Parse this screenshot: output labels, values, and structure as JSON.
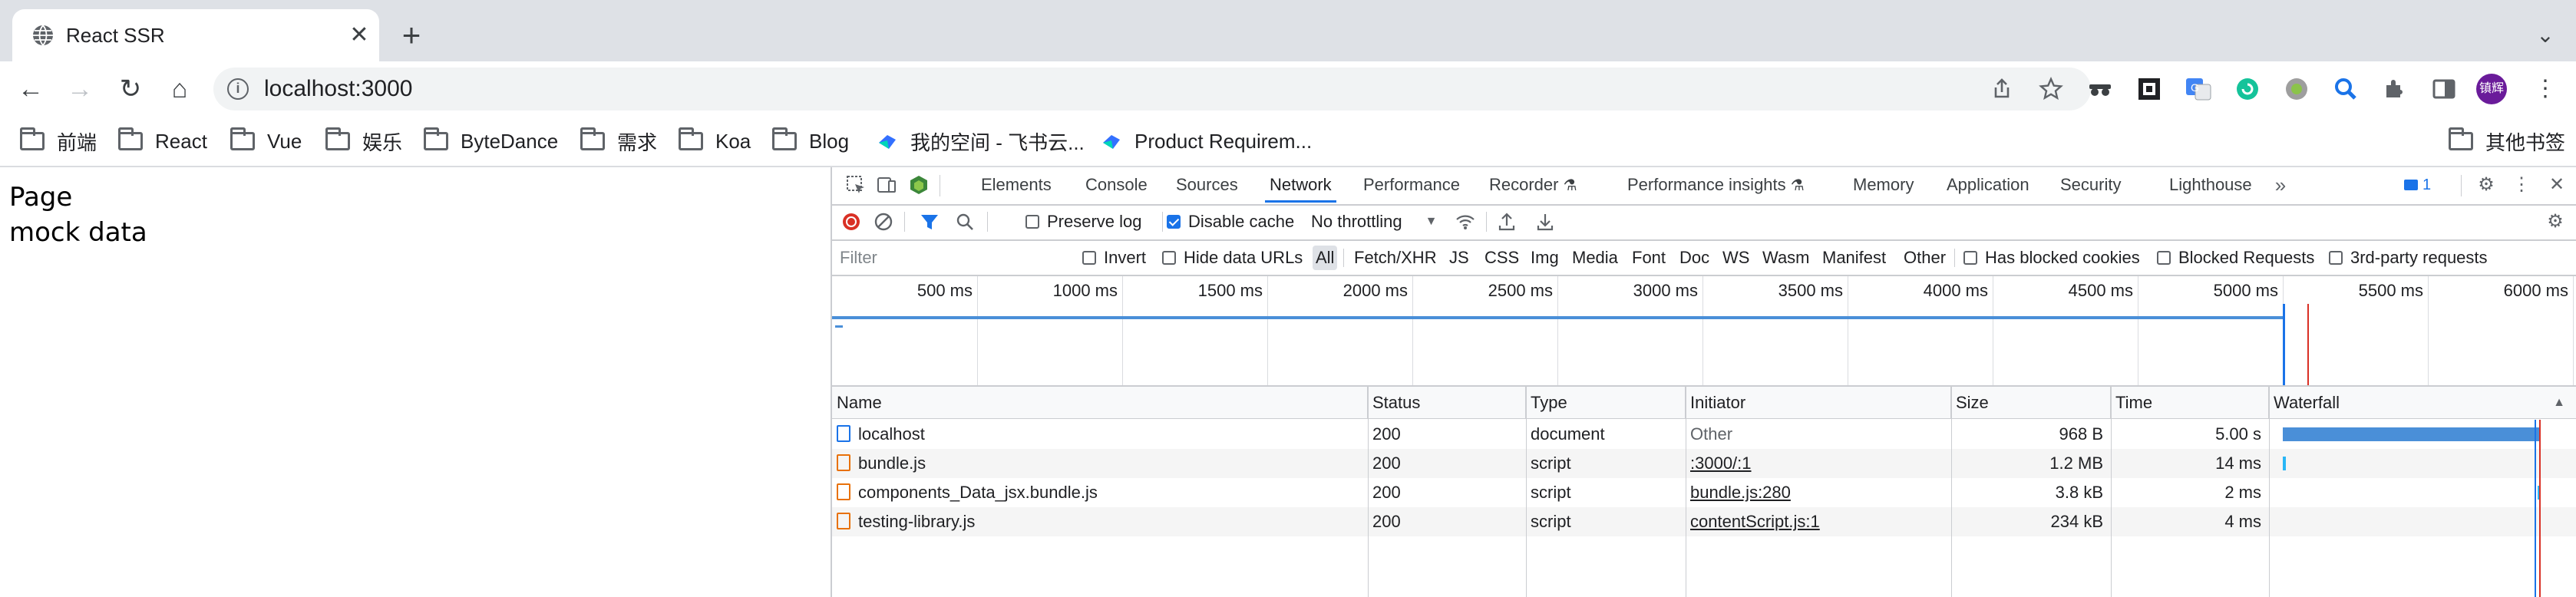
{
  "browser": {
    "tab": {
      "title": "React SSR",
      "favicon": "globe-icon",
      "close_glyph": "✕"
    },
    "new_tab_glyph": "+",
    "tab_menu_glyph": "⌄",
    "address": {
      "url": "localhost:3000"
    },
    "nav": {
      "back": "←",
      "forward": "→",
      "reload": "↻",
      "home": "⌂"
    },
    "profile_initials": "镇辉",
    "colors": {
      "tabstrip": "#dee1e6",
      "accent": "#1a73e8",
      "profile": "#6a1b9a"
    }
  },
  "bookmarks": {
    "items": [
      {
        "label": "前端",
        "icon": "folder-icon"
      },
      {
        "label": "React",
        "icon": "folder-icon"
      },
      {
        "label": "Vue",
        "icon": "folder-icon"
      },
      {
        "label": "娱乐",
        "icon": "folder-icon"
      },
      {
        "label": "ByteDance",
        "icon": "folder-icon"
      },
      {
        "label": "需求",
        "icon": "folder-icon"
      },
      {
        "label": "Koa",
        "icon": "folder-icon"
      },
      {
        "label": "Blog",
        "icon": "folder-icon"
      },
      {
        "label": "我的空间 - 飞书云...",
        "icon": "feishu-icon"
      },
      {
        "label": "Product Requirem...",
        "icon": "feishu-icon"
      }
    ],
    "other": "其他书签"
  },
  "page": {
    "lines": [
      "Page",
      "mock data"
    ]
  },
  "devtools": {
    "tabs": [
      "Elements",
      "Console",
      "Sources",
      "Network",
      "Performance",
      "Recorder",
      "Performance insights",
      "Memory",
      "Application",
      "Security",
      "Lighthouse"
    ],
    "active_tab": "Network",
    "issues_count": "1",
    "toolbar": {
      "preserve_log": "Preserve log",
      "disable_cache": "Disable cache",
      "throttling": "No throttling"
    },
    "filter": {
      "placeholder": "Filter",
      "invert": "Invert",
      "hide_data_urls": "Hide data URLs",
      "types": [
        "All",
        "Fetch/XHR",
        "JS",
        "CSS",
        "Img",
        "Media",
        "Font",
        "Doc",
        "WS",
        "Wasm",
        "Manifest",
        "Other"
      ],
      "active_type": "All",
      "has_blocked_cookies": "Has blocked cookies",
      "blocked_requests": "Blocked Requests",
      "third_party": "3rd-party requests"
    },
    "overview_ticks": [
      "500 ms",
      "1000 ms",
      "1500 ms",
      "2000 ms",
      "2500 ms",
      "3000 ms",
      "3500 ms",
      "4000 ms",
      "4500 ms",
      "5000 ms",
      "5500 ms",
      "6000 ms"
    ],
    "columns": [
      "Name",
      "Status",
      "Type",
      "Initiator",
      "Size",
      "Time",
      "Waterfall"
    ],
    "rows": [
      {
        "name": "localhost",
        "kind": "document",
        "status": "200",
        "type": "document",
        "initiator": "Other",
        "initiator_link": false,
        "size": "968 B",
        "time": "5.00 s"
      },
      {
        "name": "bundle.js",
        "kind": "script",
        "status": "200",
        "type": "script",
        "initiator": ":3000/:1",
        "initiator_link": true,
        "size": "1.2 MB",
        "time": "14 ms"
      },
      {
        "name": "components_Data_jsx.bundle.js",
        "kind": "script",
        "status": "200",
        "type": "script",
        "initiator": "bundle.js:280",
        "initiator_link": true,
        "size": "3.8 kB",
        "time": "2 ms"
      },
      {
        "name": "testing-library.js",
        "kind": "script",
        "status": "200",
        "type": "script",
        "initiator": "contentScript.js:1",
        "initiator_link": true,
        "size": "234 kB",
        "time": "4 ms"
      }
    ]
  }
}
